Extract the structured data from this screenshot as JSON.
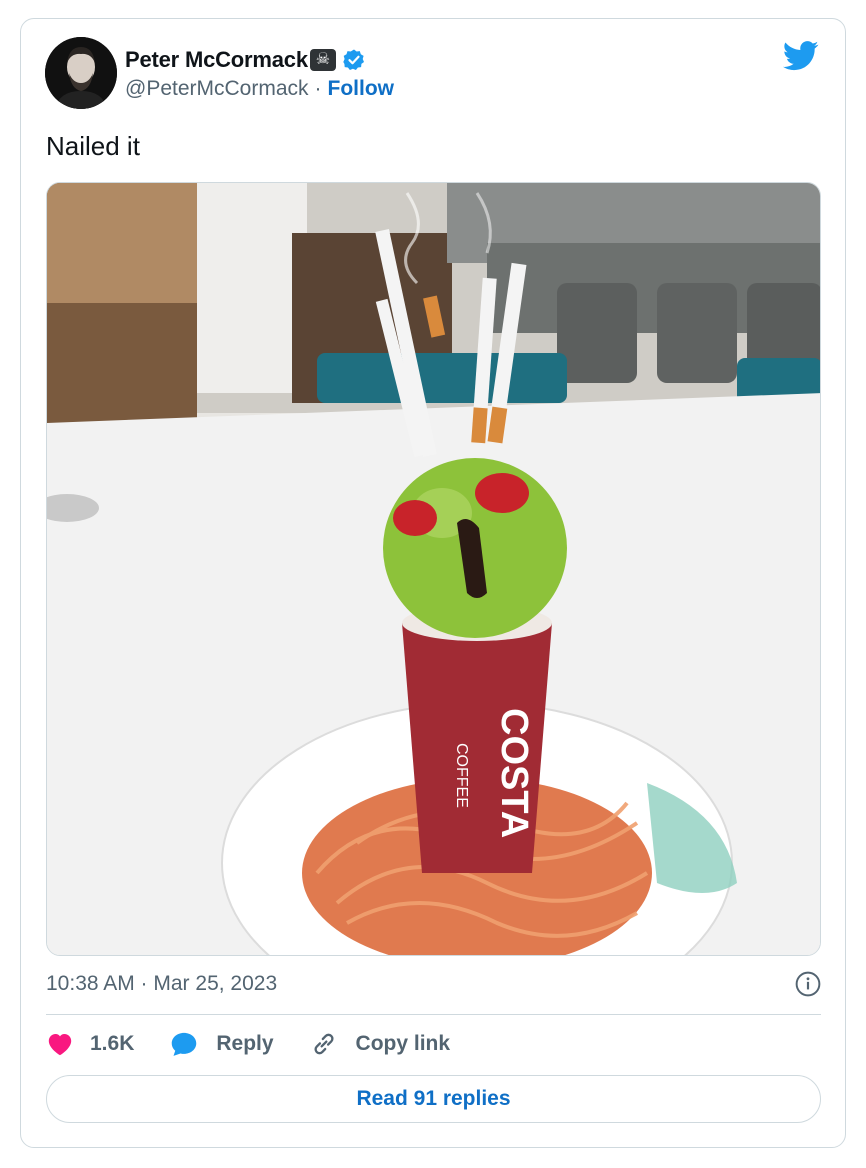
{
  "author": {
    "display_name": "Peter McCormack",
    "handle": "@PeterMcCormack",
    "separator": "·",
    "follow_label": "Follow",
    "emoji": "☠"
  },
  "tweet": {
    "text": "Nailed it",
    "timestamp": "10:38 AM · Mar 25, 2023"
  },
  "actions": {
    "like_count": "1.6K",
    "reply_label": "Reply",
    "copy_link_label": "Copy link"
  },
  "footer": {
    "read_replies_label": "Read 91 replies"
  },
  "photo": {
    "cup_brand": "COSTA",
    "cup_sub": "COFFEE"
  },
  "colors": {
    "brand_blue": "#1d9bf0",
    "link_blue": "#0f6fc6",
    "like_pink": "#f91880",
    "border": "#cfd9de",
    "secondary_text": "#536471"
  }
}
